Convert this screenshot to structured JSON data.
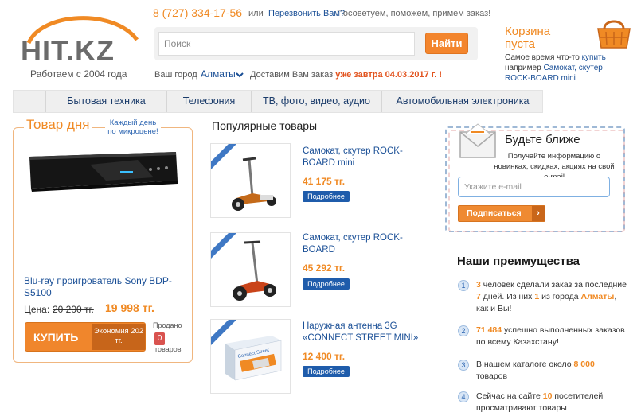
{
  "header": {
    "logo_text": "HIT.KZ",
    "logo_subtitle": "Работаем с 2004 года",
    "phone": "8 (727) 334-17-56",
    "phone_or": "или",
    "callback_link": "Перезвонить Вам?",
    "advice": "Посоветуем, поможем, примем заказ!",
    "search_placeholder": "Поиск",
    "search_button": "Найти",
    "city_label": "Ваш город",
    "city_value": "Алматы",
    "deliver_text": "Доставим Вам заказ",
    "deliver_date": "уже завтра 04.03.2017 г.",
    "deliver_bang": "!"
  },
  "cart": {
    "title": "Корзина пуста",
    "text_prefix": "Самое время что-то",
    "buy_link": "купить",
    "text_mid": "например",
    "example_link": "Самокат, скутер ROCK-BOARD mini"
  },
  "nav": {
    "items": [
      "Бытовая техника",
      "Телефония",
      "ТВ, фото, видео, аудио",
      "Автомобильная электроника"
    ]
  },
  "deal": {
    "title": "Товар дня",
    "note": "Каждый день по микроцене!",
    "product_name": "Blu-ray проигрователь Sony BDP-S5100",
    "price_label": "Цена:",
    "old_price": "20 200 тг.",
    "new_price": "19 998 тг.",
    "buy_label": "КУПИТЬ",
    "savings": "Экономия 202 тг.",
    "sold_label": "Продано",
    "sold_count": "0",
    "sold_unit": "товаров"
  },
  "popular": {
    "title": "Популярные товары",
    "more_label": "Подробнее",
    "items": [
      {
        "name": "Самокат, скутер ROCK-BOARD mini",
        "price": "41 175 тг."
      },
      {
        "name": "Самокат, скутер ROCK-BOARD",
        "price": "45 292 тг."
      },
      {
        "name": "Наружная антенна 3G «CONNECT STREET MINI»",
        "price": "12 400 тг."
      }
    ]
  },
  "subscribe": {
    "title": "Будьте ближе",
    "text": "Получайте информацию о новинках, скидках, акциях на свой e-mail",
    "placeholder": "Укажите e-mail",
    "button": "Подписаться"
  },
  "advantages": {
    "title": "Наши преимущества",
    "items": [
      {
        "num": "1",
        "a": "3",
        "b": " человек сделали заказ за последние ",
        "c": "7",
        "d": " дней. Из них ",
        "e": "1",
        "f": " из города ",
        "g": "Алматы",
        "h": ", как и Вы!"
      },
      {
        "num": "2",
        "a": "71 484",
        "b": " успешно выполненных заказов по всему Казахстану!"
      },
      {
        "num": "3",
        "a": "В нашем каталоге около ",
        "b": "8 000",
        "c": " товаров"
      },
      {
        "num": "4",
        "a": "Сейчас на сайте ",
        "b": "10",
        "c": " посетителей просматривают товары"
      }
    ]
  },
  "colors": {
    "accent": "#f08a24",
    "link": "#1a4f96",
    "more_button": "#1f5cab"
  }
}
